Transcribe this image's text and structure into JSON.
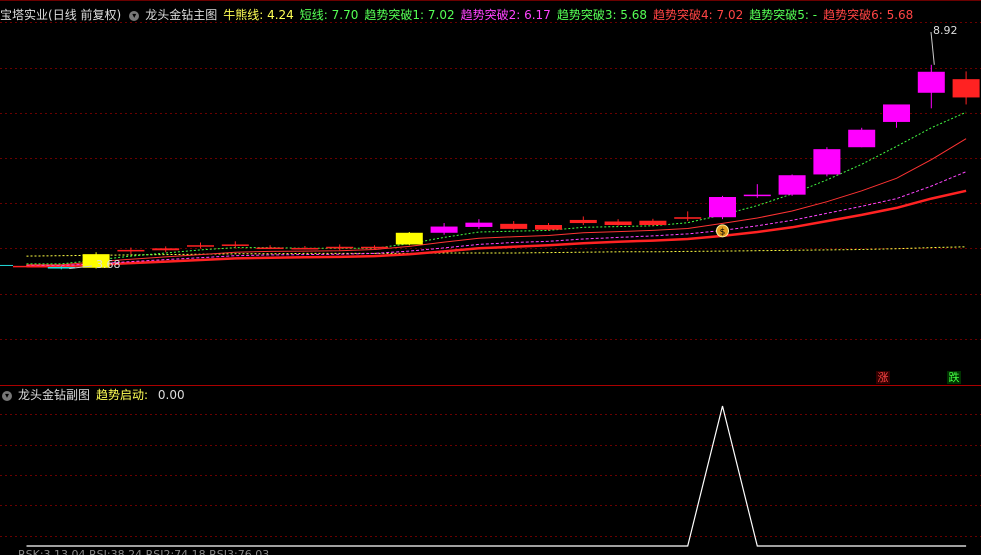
{
  "main_header": {
    "stock_name": "宝塔实业",
    "period_info": "(日线 前复权)",
    "indicator_name": "龙头金钻主图",
    "params": [
      {
        "label": "牛熊线",
        "value": "4.24",
        "color": "#ffff55"
      },
      {
        "label": "短线",
        "value": "7.70",
        "color": "#55ff55"
      },
      {
        "label": "趋势突破1",
        "value": "7.02",
        "color": "#55ff55"
      },
      {
        "label": "趋势突破2",
        "value": "6.17",
        "color": "#ff44ff"
      },
      {
        "label": "趋势突破3",
        "value": "5.68",
        "color": "#55ff55"
      },
      {
        "label": "趋势突破4",
        "value": "7.02",
        "color": "#ff4444"
      },
      {
        "label": "趋势突破5",
        "value": "-",
        "color": "#55ff55"
      },
      {
        "label": "趋势突破6",
        "value": "5.68",
        "color": "#ff4444"
      }
    ]
  },
  "sub_header": {
    "indicator_name": "龙头金钻副图",
    "param_label": "趋势启动",
    "param_value": "0.00"
  },
  "main_chart": {
    "high_label": "8.92",
    "low_label": "3.68",
    "badge_up": "涨",
    "badge_down": "跌"
  },
  "bottom_text": "RSK:3.13.04  RSI:38.24  RSI2:74.18  RSI3:76.03",
  "chart_data": {
    "type": "candlestick",
    "ylim": [
      3.0,
      9.3
    ],
    "candles": [
      {
        "o": 3.75,
        "h": 3.78,
        "l": 3.72,
        "c": 3.74,
        "color": "#ff2222"
      },
      {
        "o": 3.72,
        "h": 3.74,
        "l": 3.66,
        "c": 3.68,
        "color": "#22dddd"
      },
      {
        "o": 3.7,
        "h": 4.1,
        "l": 3.68,
        "c": 4.05,
        "color": "#ffff00"
      },
      {
        "o": 4.12,
        "h": 4.22,
        "l": 4.05,
        "c": 4.16,
        "color": "#ff2222"
      },
      {
        "o": 4.15,
        "h": 4.25,
        "l": 4.1,
        "c": 4.2,
        "color": "#ff2222"
      },
      {
        "o": 4.25,
        "h": 4.35,
        "l": 4.2,
        "c": 4.28,
        "color": "#ff2222"
      },
      {
        "o": 4.27,
        "h": 4.38,
        "l": 4.22,
        "c": 4.3,
        "color": "#ff2222"
      },
      {
        "o": 4.22,
        "h": 4.28,
        "l": 4.18,
        "c": 4.22,
        "color": "#ff2222"
      },
      {
        "o": 4.2,
        "h": 4.26,
        "l": 4.17,
        "c": 4.21,
        "color": "#ff2222"
      },
      {
        "o": 4.2,
        "h": 4.3,
        "l": 4.15,
        "c": 4.24,
        "color": "#ff2222"
      },
      {
        "o": 4.22,
        "h": 4.28,
        "l": 4.18,
        "c": 4.24,
        "color": "#ff2222"
      },
      {
        "o": 4.3,
        "h": 4.62,
        "l": 4.28,
        "c": 4.6,
        "color": "#ffff00"
      },
      {
        "o": 4.6,
        "h": 4.85,
        "l": 4.55,
        "c": 4.76,
        "color": "#ff00ff"
      },
      {
        "o": 4.75,
        "h": 4.95,
        "l": 4.7,
        "c": 4.86,
        "color": "#ff00ff"
      },
      {
        "o": 4.83,
        "h": 4.9,
        "l": 4.68,
        "c": 4.7,
        "color": "#ff2222"
      },
      {
        "o": 4.8,
        "h": 4.85,
        "l": 4.65,
        "c": 4.68,
        "color": "#ff2222"
      },
      {
        "o": 4.93,
        "h": 5.02,
        "l": 4.8,
        "c": 4.85,
        "color": "#ff2222"
      },
      {
        "o": 4.89,
        "h": 4.95,
        "l": 4.78,
        "c": 4.8,
        "color": "#ff2222"
      },
      {
        "o": 4.91,
        "h": 4.96,
        "l": 4.78,
        "c": 4.8,
        "color": "#ff2222"
      },
      {
        "o": 4.96,
        "h": 5.15,
        "l": 4.9,
        "c": 5.0,
        "color": "#ff2222"
      },
      {
        "o": 5.0,
        "h": 5.55,
        "l": 4.95,
        "c": 5.52,
        "color": "#ff00ff"
      },
      {
        "o": 5.55,
        "h": 5.85,
        "l": 5.5,
        "c": 5.58,
        "color": "#ff00ff"
      },
      {
        "o": 5.58,
        "h": 6.1,
        "l": 5.55,
        "c": 6.08,
        "color": "#ff00ff"
      },
      {
        "o": 6.1,
        "h": 6.8,
        "l": 6.05,
        "c": 6.75,
        "color": "#ff00ff"
      },
      {
        "o": 6.8,
        "h": 7.3,
        "l": 6.8,
        "c": 7.25,
        "color": "#ff00ff"
      },
      {
        "o": 7.45,
        "h": 7.9,
        "l": 7.3,
        "c": 7.9,
        "color": "#ff00ff"
      },
      {
        "o": 8.2,
        "h": 8.92,
        "l": 7.8,
        "c": 8.74,
        "color": "#ff00ff"
      },
      {
        "o": 8.55,
        "h": 8.75,
        "l": 7.9,
        "c": 8.08,
        "color": "#ff2222"
      }
    ],
    "series": [
      {
        "color": "#ffff44",
        "dash": "2,2",
        "width": 1,
        "values": [
          4.0,
          4.01,
          4.02,
          4.03,
          4.04,
          4.05,
          4.06,
          4.06,
          4.07,
          4.07,
          4.07,
          4.07,
          4.08,
          4.08,
          4.08,
          4.09,
          4.1,
          4.11,
          4.11,
          4.12,
          4.13,
          4.14,
          4.15,
          4.16,
          4.17,
          4.19,
          4.22,
          4.24
        ]
      },
      {
        "color": "#ff2222",
        "dash": "",
        "width": 2.5,
        "values": [
          3.74,
          3.74,
          3.78,
          3.82,
          3.86,
          3.9,
          3.94,
          3.96,
          3.97,
          3.98,
          4.0,
          4.05,
          4.12,
          4.2,
          4.24,
          4.28,
          4.33,
          4.37,
          4.4,
          4.44,
          4.52,
          4.62,
          4.74,
          4.9,
          5.06,
          5.24,
          5.48,
          5.68
        ]
      },
      {
        "color": "#ff44ff",
        "dash": "3,2",
        "width": 1,
        "values": [
          3.76,
          3.76,
          3.8,
          3.86,
          3.91,
          3.96,
          4.01,
          4.03,
          4.04,
          4.05,
          4.07,
          4.13,
          4.21,
          4.3,
          4.35,
          4.38,
          4.44,
          4.48,
          4.52,
          4.57,
          4.66,
          4.78,
          4.92,
          5.1,
          5.28,
          5.48,
          5.8,
          6.17
        ]
      },
      {
        "color": "#ff3333",
        "dash": "",
        "width": 1,
        "values": [
          3.78,
          3.78,
          3.85,
          3.92,
          3.98,
          4.04,
          4.1,
          4.12,
          4.13,
          4.14,
          4.17,
          4.25,
          4.36,
          4.46,
          4.5,
          4.53,
          4.6,
          4.63,
          4.66,
          4.71,
          4.84,
          4.98,
          5.16,
          5.4,
          5.68,
          6.0,
          6.48,
          7.02
        ]
      },
      {
        "color": "#44ff44",
        "dash": "2,2",
        "width": 1,
        "values": [
          3.8,
          3.8,
          3.9,
          4.0,
          4.08,
          4.16,
          4.22,
          4.22,
          4.2,
          4.2,
          4.2,
          4.32,
          4.48,
          4.62,
          4.64,
          4.66,
          4.74,
          4.76,
          4.78,
          4.86,
          5.06,
          5.3,
          5.6,
          5.96,
          6.36,
          6.82,
          7.3,
          7.7
        ]
      }
    ],
    "sub_series": {
      "color": "#ffffff",
      "values": [
        0,
        0,
        0,
        0,
        0,
        0,
        0,
        0,
        0,
        0,
        0,
        0,
        0,
        0,
        0,
        0,
        0,
        0,
        0,
        0,
        1,
        0,
        0,
        0,
        0,
        0,
        0,
        0
      ],
      "ylim": [
        0,
        1
      ]
    }
  }
}
